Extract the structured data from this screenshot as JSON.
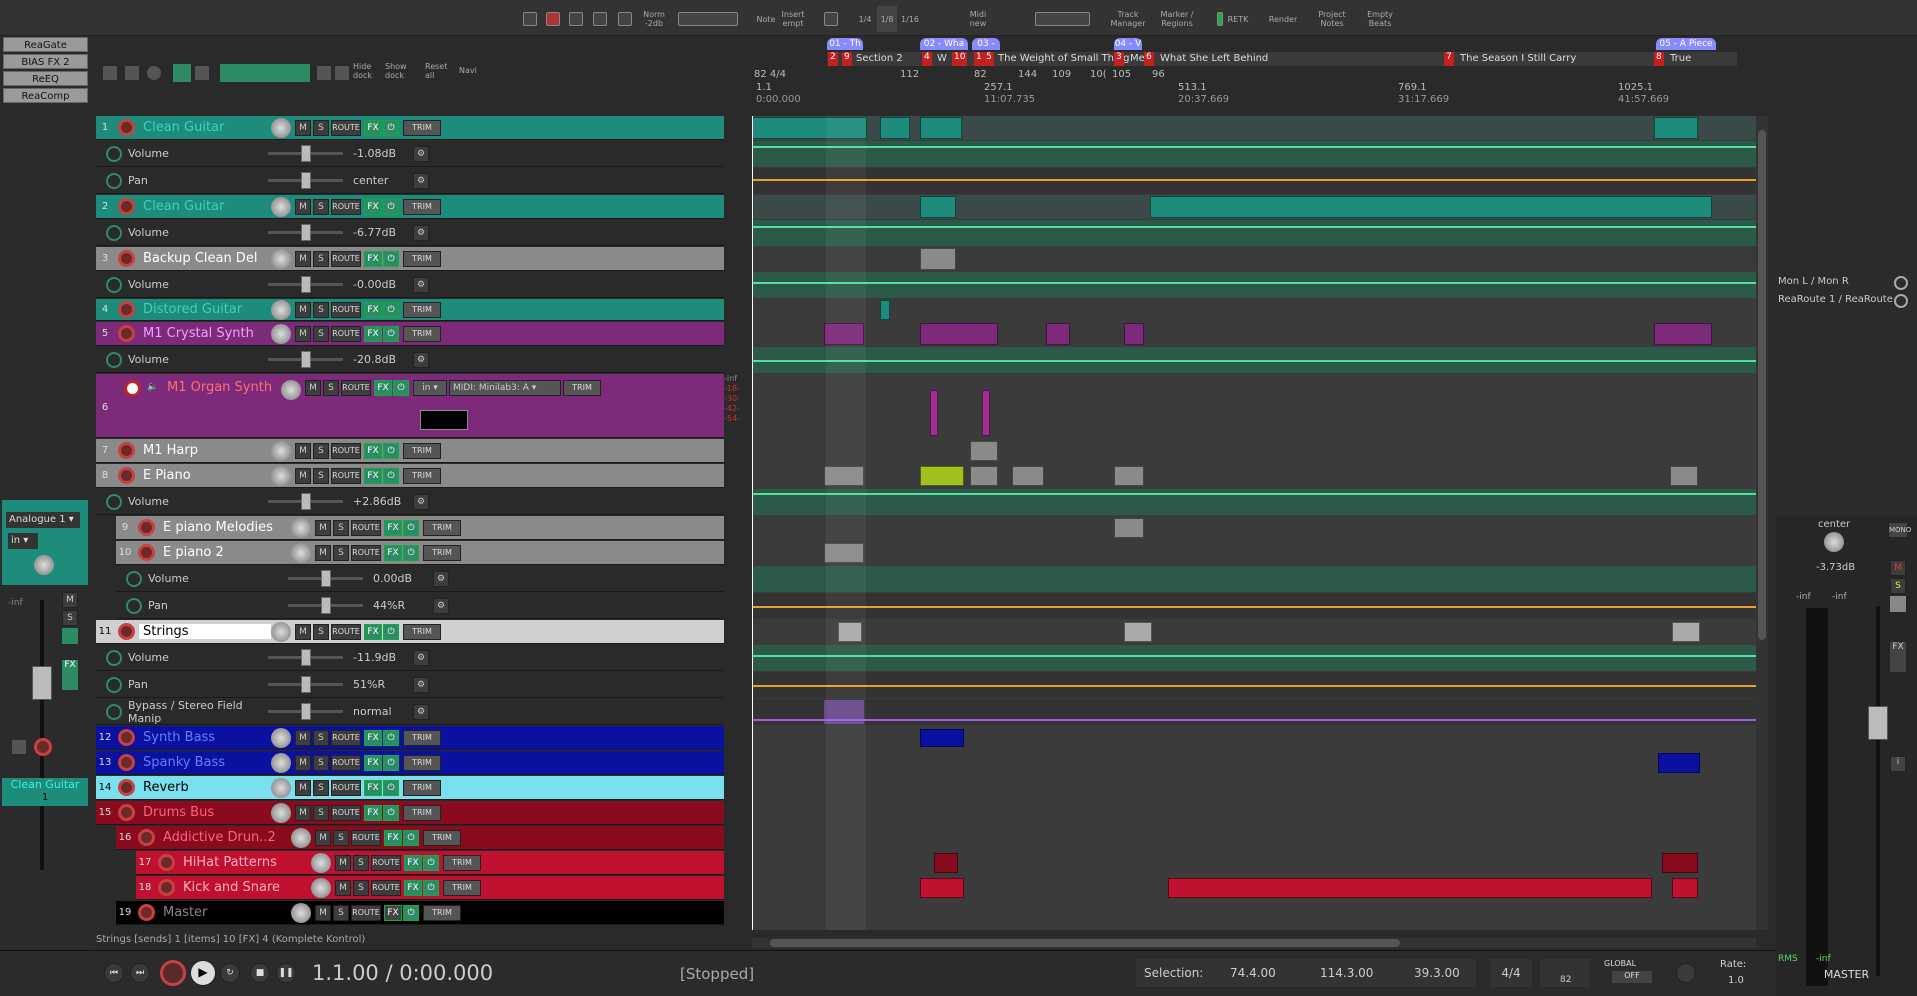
{
  "toolbar": {
    "items": [
      "Norm -2db",
      "Note",
      "Insert empt",
      "1/4",
      "1/8",
      "1/16",
      "Midi new",
      "Track Manager",
      "Marker / Regions",
      "RETK",
      "Render",
      "Project Notes",
      "Empty Beats"
    ],
    "hide_dock": "Hide dock",
    "show_dock": "Show dock",
    "reset_all": "Reset all",
    "navi": "Navi"
  },
  "fx_chain": [
    "ReaGate",
    "BIAS FX 2",
    "ReEQ",
    "ReaComp"
  ],
  "mcp_left": {
    "input_device": "Analogue 1",
    "input_mode": "in",
    "vol": "-inf",
    "track_name": "Clean Guitar",
    "track_number": "1"
  },
  "regions": [
    {
      "label": "01 - Th"
    },
    {
      "label": "02 - Wha"
    },
    {
      "label": "03 -"
    },
    {
      "label": "04 - V"
    },
    {
      "label": "05 - A Piece"
    }
  ],
  "markers": [
    {
      "num": "2"
    },
    {
      "num": "9",
      "label": "Section 2"
    },
    {
      "num": "4",
      "label": "W"
    },
    {
      "num": "10"
    },
    {
      "num": "1"
    },
    {
      "num": "5",
      "label": "The Weight of Small Thing"
    },
    {
      "num": "3",
      "label": "Me"
    },
    {
      "num": "6",
      "label": "What She Left Behind"
    },
    {
      "num": "7",
      "label": "The Season I Still Carry"
    },
    {
      "num": "8",
      "label": "True"
    }
  ],
  "ruler": {
    "time_sig": "82 4/4",
    "top_labels": [
      "112",
      "82",
      "144",
      "109",
      "10(",
      "105",
      "96"
    ],
    "bars": [
      "1.1",
      "257.1",
      "513.1",
      "769.1",
      "1025.1"
    ],
    "times": [
      "0:00.000",
      "11:07.735",
      "20:37.669",
      "31:17.669",
      "41:57.669"
    ]
  },
  "tracks": [
    {
      "num": "1",
      "name": "Clean Guitar",
      "color": "#1e8c7a",
      "text": "#40d0c0"
    },
    {
      "env": "Volume",
      "val": "-1.08dB"
    },
    {
      "env": "Pan",
      "val": "center"
    },
    {
      "num": "2",
      "name": "Clean Guitar",
      "color": "#1e8c7a",
      "text": "#40d0c0"
    },
    {
      "env": "Volume",
      "val": "-6.77dB"
    },
    {
      "num": "3",
      "name": "Backup Clean Del",
      "color": "#8a8a8a",
      "text": "#ffffff"
    },
    {
      "env": "Volume",
      "val": "-0.00dB"
    },
    {
      "num": "4",
      "name": "Distored Guitar",
      "color": "#1e8c7a",
      "text": "#40d0c0"
    },
    {
      "num": "5",
      "name": "M1 Crystal Synth",
      "color": "#7d2a7a",
      "text": "#f0a0ff"
    },
    {
      "env": "Volume",
      "val": "-20.8dB"
    },
    {
      "num": "6",
      "name": "M1 Organ Synth",
      "color": "#7d2a7a",
      "text": "#ff7070"
    },
    {
      "num": "7",
      "name": "M1 Harp",
      "color": "#8a8a8a",
      "text": "#ffffff"
    },
    {
      "num": "8",
      "name": "E Piano",
      "color": "#8a8a8a",
      "text": "#ffffff"
    },
    {
      "env": "Volume",
      "val": "+2.86dB"
    },
    {
      "num": "9",
      "name": "E piano Melodies",
      "color": "#8a8a8a",
      "text": "#ffffff"
    },
    {
      "num": "10",
      "name": "E piano 2",
      "color": "#8a8a8a",
      "text": "#ffffff"
    },
    {
      "env": "Volume",
      "val": "0.00dB"
    },
    {
      "env": "Pan",
      "val": "44%R"
    },
    {
      "num": "11",
      "name": "Strings",
      "color": "#cfcfcf",
      "text": "#000000"
    },
    {
      "env": "Volume",
      "val": "-11.9dB"
    },
    {
      "env": "Pan",
      "val": "51%R"
    },
    {
      "env": "Bypass / Stereo Field Manip",
      "val": "normal"
    },
    {
      "num": "12",
      "name": "Synth Bass",
      "color": "#0a10a0",
      "text": "#6080ff"
    },
    {
      "num": "13",
      "name": "Spanky Bass",
      "color": "#0a10a0",
      "text": "#6080ff"
    },
    {
      "num": "14",
      "name": "Reverb",
      "color": "#7ae0f0",
      "text": "#000000"
    },
    {
      "num": "15",
      "name": "Drums Bus",
      "color": "#8a0a1e",
      "text": "#ff6080"
    },
    {
      "num": "16",
      "name": "Addictive Drun..2",
      "color": "#8a0a1e",
      "text": "#ff6080"
    },
    {
      "num": "17",
      "name": "HiHat Patterns",
      "color": "#8a0a1e",
      "text": "#ff6080"
    },
    {
      "num": "18",
      "name": "Kick and Snare",
      "color": "#8a0a1e",
      "text": "#ff6080"
    },
    {
      "num": "19",
      "name": "Master",
      "color": "#000000",
      "text": "#888888"
    }
  ],
  "organ_midi": "MIDI: Minilab3: A",
  "organ_input": "in",
  "meter_vals": [
    "-inf",
    "-18-",
    "-30-",
    "-42-",
    "-54-"
  ],
  "master": {
    "routes": [
      "Mon L / Mon R",
      "ReaRoute 1 / ReaRoute"
    ],
    "pan": "center",
    "vol": "-3.73dB",
    "meter_l": "-inf",
    "meter_r": "-inf",
    "rms": "RMS",
    "rms_val": "-inf",
    "label": "MASTER",
    "mono": "MONO"
  },
  "status": "Strings [sends] 1 [items] 10 [FX] 4 (Komplete Kontrol)",
  "transport": {
    "position": "1.1.00 / 0:00.000",
    "state": "[Stopped]",
    "selection_label": "Selection:",
    "sel_start": "74.4.00",
    "sel_end": "114.3.00",
    "sel_len": "39.3.00",
    "timesig": "4/4",
    "bpm": "82",
    "global": "GLOBAL",
    "global_state": "OFF",
    "rate_label": "Rate:",
    "rate": "1.0"
  },
  "colors": {
    "teal": "#1e8c7a",
    "accent": "#2e8c64",
    "marker": "#c42020",
    "region": "#8a8aff"
  }
}
